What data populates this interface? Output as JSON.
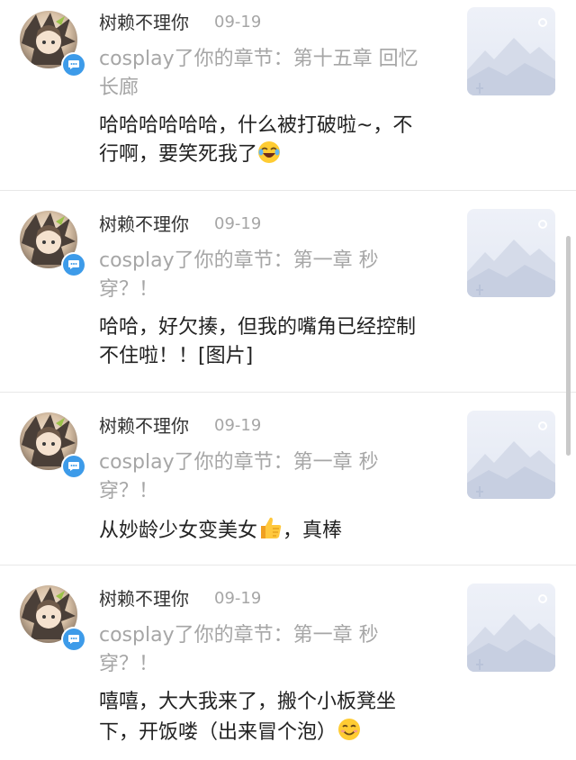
{
  "comments": [
    {
      "user": "树赖不理你",
      "date": "09-19",
      "quote": "cosplay了你的章节：第十五章  回忆长廊",
      "text": "哈哈哈哈哈哈，什么被打破啦~，不行啊，要笑死我了",
      "emoji": "laugh-emoji"
    },
    {
      "user": "树赖不理你",
      "date": "09-19",
      "quote": "cosplay了你的章节：第一章  秒穿？！",
      "text": "哈哈，好欠揍，但我的嘴角已经控制不住啦！！[图片]",
      "emoji": ""
    },
    {
      "user": "树赖不理你",
      "date": "09-19",
      "quote": "cosplay了你的章节：第一章  秒穿？！",
      "text_a": "从妙龄少女变美女",
      "text_b": "，真棒",
      "emoji": "thumbs-up-emoji"
    },
    {
      "user": "树赖不理你",
      "date": "09-19",
      "quote": "cosplay了你的章节：第一章  秒穿？！",
      "text": "嘻嘻，大大我来了，搬个小板凳坐下，开饭喽（出来冒个泡）",
      "emoji": "smile-emoji"
    }
  ],
  "colors": {
    "badge": "#3d9be9",
    "quote_text": "#a6a6a6",
    "name_text": "#333333"
  }
}
